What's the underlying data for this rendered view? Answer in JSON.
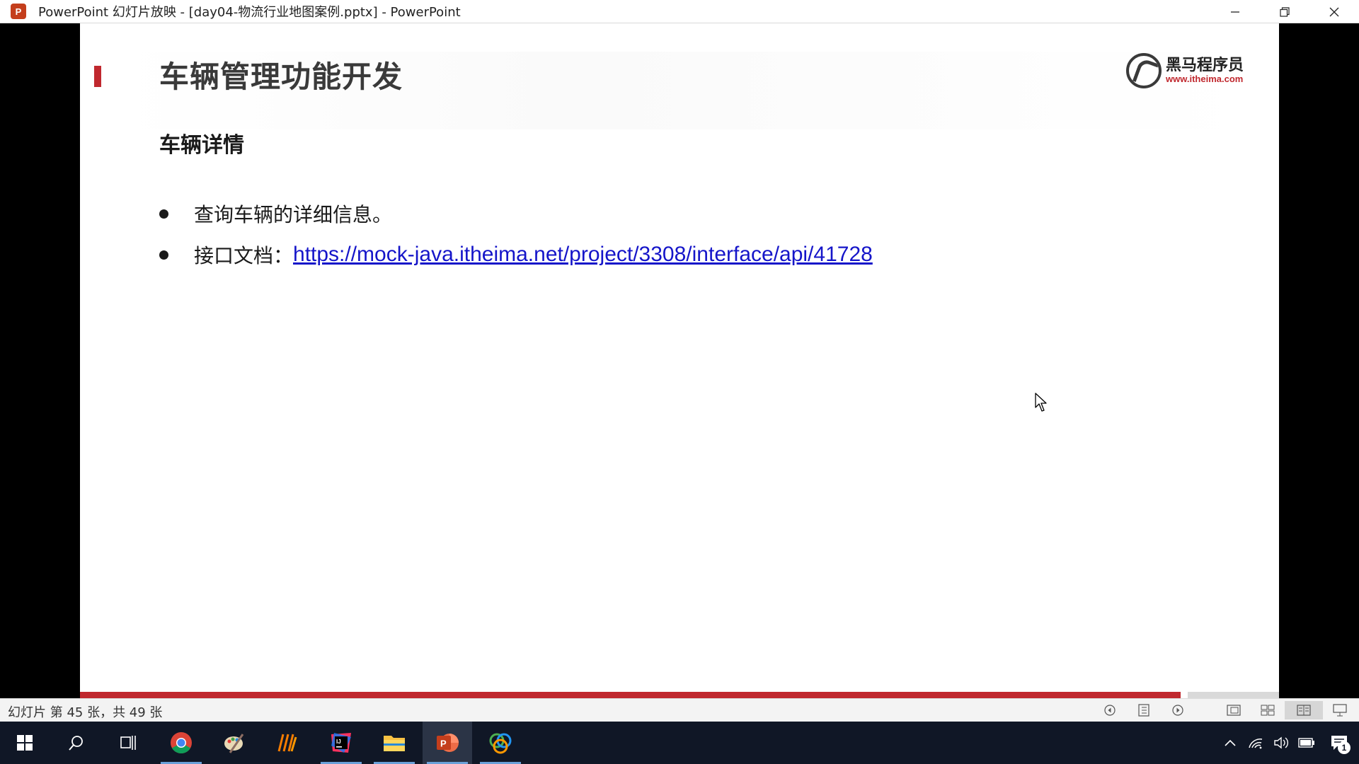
{
  "window": {
    "title": "PowerPoint 幻灯片放映 - [day04-物流行业地图案例.pptx] - PowerPoint",
    "app_icon_letter": "P"
  },
  "slide": {
    "title": "车辆管理功能开发",
    "logo_cn": "黑马程序员",
    "logo_url": "www.itheima.com",
    "subtitle": "车辆详情",
    "bullets": [
      {
        "text": "查询车辆的详细信息。"
      },
      {
        "label": "接口文档：",
        "link": "https://mock-java.itheima.net/project/3308/interface/api/41728"
      }
    ],
    "progress_fraction": 0.918
  },
  "status": {
    "slide_counter": "幻灯片 第 45 张，共 49 张"
  },
  "colors": {
    "accent_red": "#c0282e",
    "link_blue": "#1515c9",
    "taskbar_bg": "#101726"
  },
  "taskbar": {
    "apps": [
      "windows-start-icon",
      "search-icon",
      "task-view-icon",
      "chrome-icon",
      "paint-icon",
      "sublime-icon",
      "intellij-icon",
      "file-explorer-icon",
      "powerpoint-icon",
      "fork-icon"
    ],
    "notification_count": "1"
  }
}
